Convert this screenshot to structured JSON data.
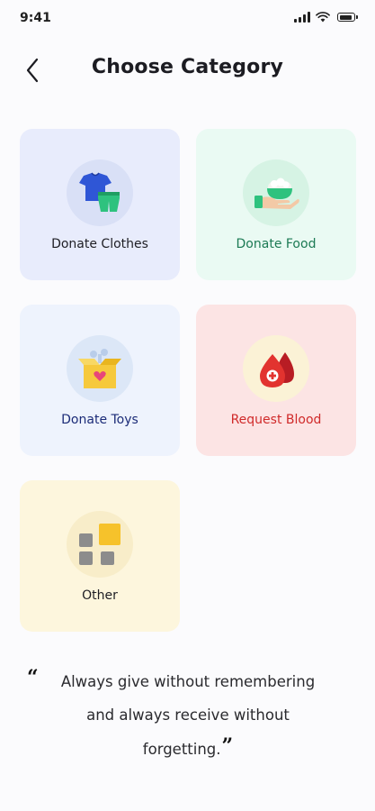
{
  "status_bar": {
    "time": "9:41"
  },
  "header": {
    "title": "Choose Category"
  },
  "categories": [
    {
      "label": "Donate Clothes",
      "bg": "#e8ecfc",
      "circle": "#d9e0f6",
      "text_color": "#1e1e24",
      "icon": "clothes-icon"
    },
    {
      "label": "Donate Food",
      "bg": "#eafaf3",
      "circle": "#d6f3e4",
      "text_color": "#1c7a54",
      "icon": "food-icon"
    },
    {
      "label": "Donate Toys",
      "bg": "#eef3fd",
      "circle": "#dce7f7",
      "text_color": "#1c2c78",
      "icon": "toy-box-icon"
    },
    {
      "label": "Request Blood",
      "bg": "#fce4e4",
      "circle": "#fbf2d6",
      "text_color": "#d02a2a",
      "icon": "blood-drop-icon"
    },
    {
      "label": "Other",
      "bg": "#fdf6dd",
      "circle": "#f8edc9",
      "text_color": "#1e1e24",
      "icon": "grid-icon"
    }
  ],
  "quote": {
    "open_mark": "“",
    "close_mark": "”",
    "line1": "Always give without remembering",
    "line2": "and always receive without",
    "line3": "forgetting."
  }
}
